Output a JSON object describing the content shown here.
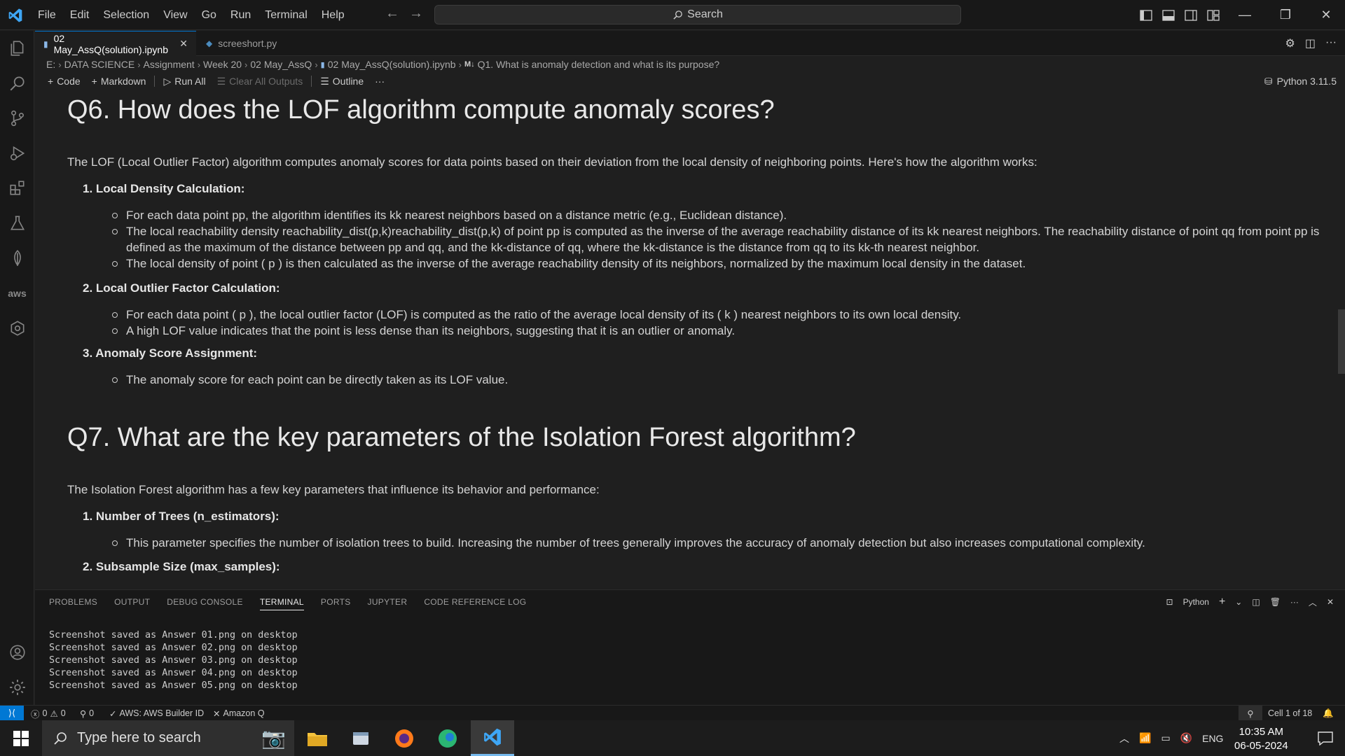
{
  "menu": [
    "File",
    "Edit",
    "Selection",
    "View",
    "Go",
    "Run",
    "Terminal",
    "Help"
  ],
  "search": {
    "label": "Search"
  },
  "tabs": [
    {
      "label": "02 May_AssQ(solution).ipynb"
    },
    {
      "label": "screeshort.py"
    }
  ],
  "breadcrumb": [
    "E:",
    "DATA SCIENCE",
    "Assignment",
    "Week 20",
    "02 May_AssQ",
    "02 May_AssQ(solution).ipynb",
    "Q1. What is anomaly detection and what is its purpose?"
  ],
  "breadcrumb_md_badge": "M↓",
  "toolbar": {
    "code": "Code",
    "markdown": "Markdown",
    "run_all": "Run All",
    "clear_outputs": "Clear All Outputs",
    "outline": "Outline",
    "more": "···",
    "kernel": "Python 3.11.5"
  },
  "notebook": {
    "q6": {
      "heading": "Q6. How does the LOF algorithm compute anomaly scores?",
      "intro": "The LOF (Local Outlier Factor) algorithm computes anomaly scores for data points based on their deviation from the local density of neighboring points. Here's how the algorithm works:",
      "steps": [
        {
          "title": "Local Density Calculation:",
          "bullets": [
            "For each data point pp, the algorithm identifies its kk nearest neighbors based on a distance metric (e.g., Euclidean distance).",
            "The local reachability density reachability_dist(p,k)reachability_dist(p,k) of point pp is computed as the inverse of the average reachability distance of its kk nearest neighbors. The reachability distance of point qq from point pp is defined as the maximum of the distance between pp and qq, and the kk-distance of qq, where the kk-distance is the distance from qq to its kk-th nearest neighbor.",
            "The local density of point ( p ) is then calculated as the inverse of the average reachability density of its neighbors, normalized by the maximum local density in the dataset."
          ]
        },
        {
          "title": "Local Outlier Factor Calculation:",
          "bullets": [
            "For each data point ( p ), the local outlier factor (LOF) is computed as the ratio of the average local density of its ( k ) nearest neighbors to its own local density.",
            "A high LOF value indicates that the point is less dense than its neighbors, suggesting that it is an outlier or anomaly."
          ]
        },
        {
          "title": "Anomaly Score Assignment:",
          "bullets": [
            "The anomaly score for each point can be directly taken as its LOF value."
          ]
        }
      ]
    },
    "q7": {
      "heading": "Q7. What are the key parameters of the Isolation Forest algorithm?",
      "intro": "The Isolation Forest algorithm has a few key parameters that influence its behavior and performance:",
      "steps": [
        {
          "title": "Number of Trees (n_estimators):",
          "bullets": [
            "This parameter specifies the number of isolation trees to build. Increasing the number of trees generally improves the accuracy of anomaly detection but also increases computational complexity."
          ]
        },
        {
          "title": "Subsample Size (max_samples):",
          "bullets": []
        }
      ]
    }
  },
  "panel": {
    "tabs": [
      "PROBLEMS",
      "OUTPUT",
      "DEBUG CONSOLE",
      "TERMINAL",
      "PORTS",
      "JUPYTER",
      "CODE REFERENCE LOG"
    ],
    "active_tab": "TERMINAL",
    "shell": "Python",
    "terminal_lines": [
      "Screenshot saved as Answer 01.png on desktop",
      "Screenshot saved as Answer 02.png on desktop",
      "Screenshot saved as Answer 03.png on desktop",
      "Screenshot saved as Answer 04.png on desktop",
      "Screenshot saved as Answer 05.png on desktop"
    ]
  },
  "statusbar": {
    "errors": "0",
    "warnings": "0",
    "ports": "0",
    "aws": "AWS: AWS Builder ID",
    "amazon_q": "Amazon Q",
    "cell": "Cell 1 of 18"
  },
  "taskbar": {
    "search_placeholder": "Type here to search",
    "lang": "ENG",
    "time": "10:35 AM",
    "date": "06-05-2024"
  },
  "colors": {
    "accent": "#0078d4",
    "editor_bg": "#1f1f1f",
    "chrome_bg": "#181818"
  }
}
